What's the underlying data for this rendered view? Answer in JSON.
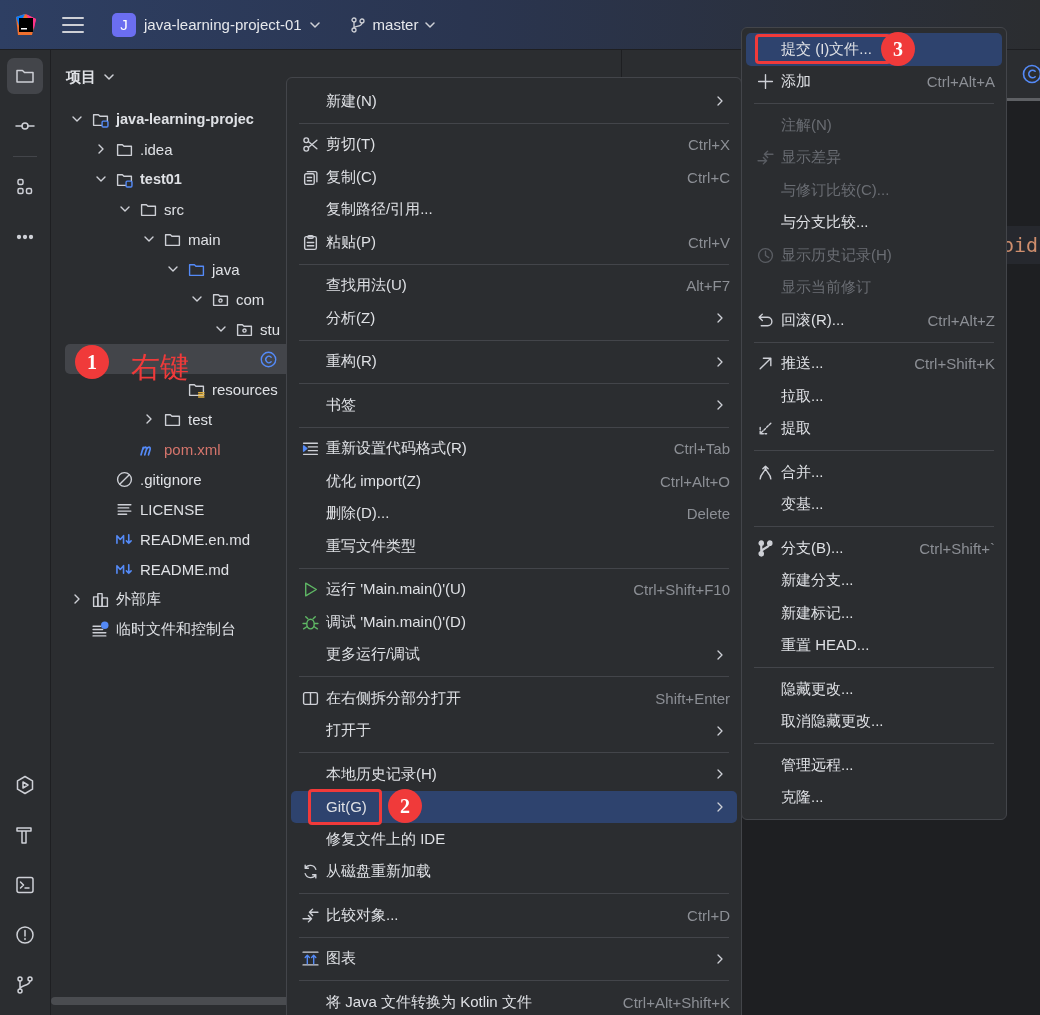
{
  "toolbar": {
    "project_initial": "J",
    "project": "java-learning-project-01",
    "branch": "master"
  },
  "tool_strip": [
    {
      "selected": true
    },
    {
      "selected": false
    },
    {
      "selected": false
    },
    {
      "selected": false
    },
    {
      "selected": false
    },
    {
      "selected": false
    },
    {
      "selected": false
    },
    {
      "selected": false
    },
    {
      "selected": false
    }
  ],
  "project_panel": {
    "title": "项目",
    "tree": [
      {
        "label": "java-learning-projec",
        "kind": "module",
        "expanded": true,
        "selected": false,
        "unversioned": false,
        "children": [
          {
            "label": ".idea",
            "kind": "folder",
            "expanded": false,
            "selected": false,
            "unversioned": false
          },
          {
            "label": "test01",
            "kind": "module",
            "expanded": true,
            "selected": false,
            "unversioned": false,
            "children": [
              {
                "label": "src",
                "kind": "folder",
                "expanded": true,
                "selected": false,
                "unversioned": false,
                "children": [
                  {
                    "label": "main",
                    "kind": "folder",
                    "expanded": true,
                    "selected": false,
                    "unversioned": false,
                    "children": [
                      {
                        "label": "java",
                        "kind": "source",
                        "expanded": true,
                        "selected": false,
                        "unversioned": false,
                        "children": [
                          {
                            "label": "com",
                            "kind": "package",
                            "expanded": true,
                            "selected": false,
                            "unversioned": false,
                            "children": [
                              {
                                "label": "stu",
                                "kind": "package",
                                "expanded": true,
                                "selected": false,
                                "unversioned": false,
                                "children": [
                                  {
                                    "kind": "class",
                                    "selected": true
                                  }
                                ]
                              }
                            ]
                          }
                        ]
                      },
                      {
                        "label": "resources",
                        "kind": "resources",
                        "selected": false,
                        "unversioned": false
                      }
                    ]
                  },
                  {
                    "label": "test",
                    "kind": "folder",
                    "expanded": false,
                    "selected": false,
                    "unversioned": false
                  }
                ]
              },
              {
                "label": "pom.xml",
                "kind": "maven",
                "selected": false,
                "unversioned": true
              }
            ]
          },
          {
            "label": ".gitignore",
            "kind": "ignore",
            "selected": false,
            "unversioned": false
          },
          {
            "label": "LICENSE",
            "kind": "text",
            "selected": false,
            "unversioned": false
          },
          {
            "label": "README.en.md",
            "kind": "markdown",
            "selected": false,
            "unversioned": false
          },
          {
            "label": "README.md",
            "kind": "markdown",
            "selected": false,
            "unversioned": false
          }
        ]
      },
      {
        "label": "外部库",
        "kind": "library",
        "expanded": false,
        "selected": false,
        "unversioned": false
      },
      {
        "label": "临时文件和控制台",
        "kind": "scratch",
        "selected": false,
        "unversioned": false
      }
    ]
  },
  "editor": {
    "code_fragment": "oid"
  },
  "context_menu": {
    "items": [
      {
        "kind": "item",
        "label": "新建(N)",
        "submenu": true,
        "selected": false
      },
      {
        "kind": "separator"
      },
      {
        "kind": "item",
        "label": "剪切(T)",
        "shortcut": "Ctrl+X",
        "submenu": false,
        "selected": false
      },
      {
        "kind": "item",
        "label": "复制(C)",
        "shortcut": "Ctrl+C",
        "submenu": false,
        "selected": false
      },
      {
        "kind": "item",
        "label": "复制路径/引用...",
        "submenu": false,
        "selected": false
      },
      {
        "kind": "item",
        "label": "粘贴(P)",
        "shortcut": "Ctrl+V",
        "submenu": false,
        "selected": false
      },
      {
        "kind": "separator"
      },
      {
        "kind": "item",
        "label": "查找用法(U)",
        "shortcut": "Alt+F7",
        "submenu": false,
        "selected": false
      },
      {
        "kind": "item",
        "label": "分析(Z)",
        "submenu": true,
        "selected": false
      },
      {
        "kind": "separator"
      },
      {
        "kind": "item",
        "label": "重构(R)",
        "submenu": true,
        "selected": false
      },
      {
        "kind": "separator"
      },
      {
        "kind": "item",
        "label": "书签",
        "submenu": true,
        "selected": false
      },
      {
        "kind": "separator"
      },
      {
        "kind": "item",
        "label": "重新设置代码格式(R)",
        "shortcut": "Ctrl+Tab",
        "submenu": false,
        "selected": false
      },
      {
        "kind": "item",
        "label": "优化 import(Z)",
        "shortcut": "Ctrl+Alt+O",
        "submenu": false,
        "selected": false
      },
      {
        "kind": "item",
        "label": "删除(D)...",
        "shortcut": "Delete",
        "submenu": false,
        "selected": false
      },
      {
        "kind": "item",
        "label": "重写文件类型",
        "submenu": false,
        "selected": false
      },
      {
        "kind": "separator"
      },
      {
        "kind": "item",
        "label": "运行 'Main.main()'(U)",
        "shortcut": "Ctrl+Shift+F10",
        "submenu": false,
        "selected": false
      },
      {
        "kind": "item",
        "label": "调试 'Main.main()'(D)",
        "submenu": false,
        "selected": false
      },
      {
        "kind": "item",
        "label": "更多运行/调试",
        "submenu": true,
        "selected": false
      },
      {
        "kind": "separator"
      },
      {
        "kind": "item",
        "label": "在右侧拆分部分打开",
        "shortcut": "Shift+Enter",
        "submenu": false,
        "selected": false
      },
      {
        "kind": "item",
        "label": "打开于",
        "submenu": true,
        "selected": false
      },
      {
        "kind": "separator"
      },
      {
        "kind": "item",
        "label": "本地历史记录(H)",
        "submenu": true,
        "selected": false
      },
      {
        "kind": "item",
        "label": "Git(G)",
        "submenu": true,
        "selected": true
      },
      {
        "kind": "item",
        "label": "修复文件上的 IDE",
        "submenu": false,
        "selected": false
      },
      {
        "kind": "item",
        "label": "从磁盘重新加载",
        "submenu": false,
        "selected": false
      },
      {
        "kind": "separator"
      },
      {
        "kind": "item",
        "label": "比较对象...",
        "shortcut": "Ctrl+D",
        "submenu": false,
        "selected": false
      },
      {
        "kind": "separator"
      },
      {
        "kind": "item",
        "label": "图表",
        "submenu": true,
        "selected": false
      },
      {
        "kind": "separator"
      },
      {
        "kind": "item",
        "label": "将 Java 文件转换为 Kotlin 文件",
        "shortcut": "Ctrl+Alt+Shift+K",
        "submenu": false,
        "selected": false
      }
    ]
  },
  "git_submenu": {
    "items": [
      {
        "kind": "item",
        "label": "提交 (I)文件...",
        "selected": true,
        "disabled": false
      },
      {
        "kind": "item",
        "label": "添加",
        "shortcut": "Ctrl+Alt+A",
        "selected": false,
        "disabled": false
      },
      {
        "kind": "separator"
      },
      {
        "kind": "item",
        "label": "注解(N)",
        "selected": false,
        "disabled": true
      },
      {
        "kind": "item",
        "label": "显示差异",
        "selected": false,
        "disabled": true
      },
      {
        "kind": "item",
        "label": "与修订比较(C)...",
        "selected": false,
        "disabled": true
      },
      {
        "kind": "item",
        "label": "与分支比较...",
        "selected": false,
        "disabled": false
      },
      {
        "kind": "item",
        "label": "显示历史记录(H)",
        "selected": false,
        "disabled": true
      },
      {
        "kind": "item",
        "label": "显示当前修订",
        "selected": false,
        "disabled": true
      },
      {
        "kind": "item",
        "label": "回滚(R)...",
        "shortcut": "Ctrl+Alt+Z",
        "selected": false,
        "disabled": false
      },
      {
        "kind": "separator"
      },
      {
        "kind": "item",
        "label": "推送...",
        "shortcut": "Ctrl+Shift+K",
        "selected": false,
        "disabled": false
      },
      {
        "kind": "item",
        "label": "拉取...",
        "selected": false,
        "disabled": false
      },
      {
        "kind": "item",
        "label": "提取",
        "selected": false,
        "disabled": false
      },
      {
        "kind": "separator"
      },
      {
        "kind": "item",
        "label": "合并...",
        "selected": false,
        "disabled": false
      },
      {
        "kind": "item",
        "label": "变基...",
        "selected": false,
        "disabled": false
      },
      {
        "kind": "separator"
      },
      {
        "kind": "item",
        "label": "分支(B)...",
        "shortcut": "Ctrl+Shift+`",
        "selected": false,
        "disabled": false
      },
      {
        "kind": "item",
        "label": "新建分支...",
        "selected": false,
        "disabled": false
      },
      {
        "kind": "item",
        "label": "新建标记...",
        "selected": false,
        "disabled": false
      },
      {
        "kind": "item",
        "label": "重置 HEAD...",
        "selected": false,
        "disabled": false
      },
      {
        "kind": "separator"
      },
      {
        "kind": "item",
        "label": "隐藏更改...",
        "selected": false,
        "disabled": false
      },
      {
        "kind": "item",
        "label": "取消隐藏更改...",
        "selected": false,
        "disabled": false
      },
      {
        "kind": "separator"
      },
      {
        "kind": "item",
        "label": "管理远程...",
        "selected": false,
        "disabled": false
      },
      {
        "kind": "item",
        "label": "克隆...",
        "selected": false,
        "disabled": false
      }
    ]
  },
  "annotations": [
    {
      "number": "1",
      "note": "右键"
    },
    {
      "number": "2"
    },
    {
      "number": "3"
    }
  ]
}
